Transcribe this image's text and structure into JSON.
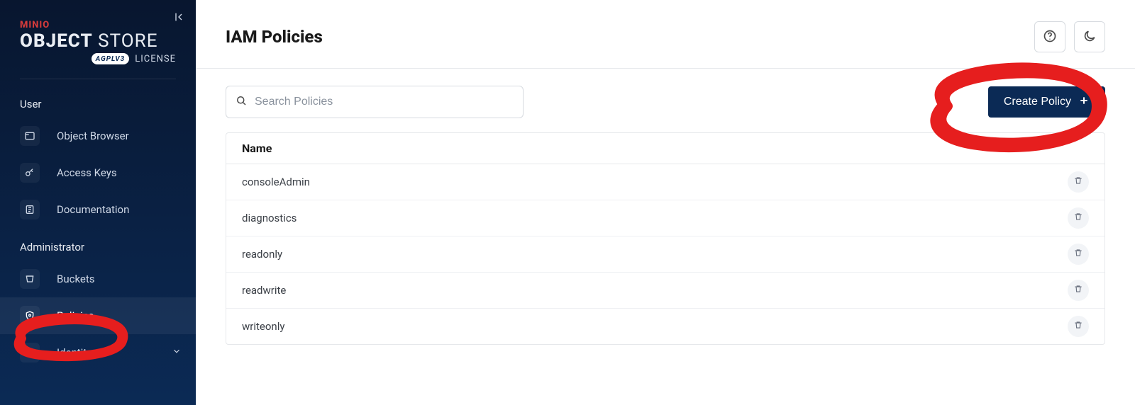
{
  "brand": {
    "top": "MINIO",
    "main_bold": "OBJECT",
    "main_light": " STORE",
    "badge": "AGPLV3",
    "license": "LICENSE"
  },
  "sidebar": {
    "sections": {
      "user": "User",
      "admin": "Administrator"
    },
    "items": {
      "object_browser": "Object Browser",
      "access_keys": "Access Keys",
      "documentation": "Documentation",
      "buckets": "Buckets",
      "policies": "Policies",
      "identity": "Identity"
    }
  },
  "page": {
    "title": "IAM Policies"
  },
  "search": {
    "placeholder": "Search Policies"
  },
  "buttons": {
    "create_policy": "Create Policy"
  },
  "table": {
    "header_name": "Name",
    "rows": [
      {
        "name": "consoleAdmin"
      },
      {
        "name": "diagnostics"
      },
      {
        "name": "readonly"
      },
      {
        "name": "readwrite"
      },
      {
        "name": "writeonly"
      }
    ]
  },
  "colors": {
    "accent": "#0b2a55",
    "annotation": "#e61e1e"
  }
}
